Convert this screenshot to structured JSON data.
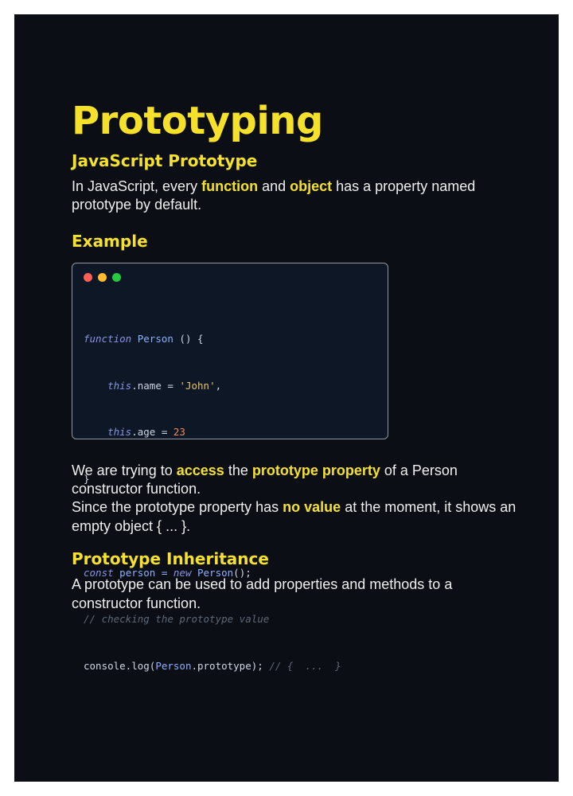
{
  "title": "Prototyping",
  "section1": {
    "heading": "JavaScript Prototype",
    "p1": "In JavaScript, every ",
    "p1_hl1": "function",
    "p1_mid": " and ",
    "p1_hl2": "object",
    "p1_end": " has a property named prototype by default."
  },
  "example": {
    "heading": "Example"
  },
  "code": {
    "l1_kw": "function",
    "l1_fn": " Person",
    "l1_rest": " () {",
    "l2_kw": "    this",
    "l2_rest": ".name = ",
    "l2_str": "'John'",
    "l2_end": ",",
    "l3_kw": "    this",
    "l3_rest": ".age = ",
    "l3_num": "23",
    "l4": "}",
    "l6_kw": "const",
    "l6_var": " person = ",
    "l6_new": "new",
    "l6_fn": " Person",
    "l6_end": "();",
    "l7_cm": "// checking the prototype value",
    "l8_a": "console.log(",
    "l8_fn": "Person",
    "l8_b": ".prototype); ",
    "l8_cm": "// {  ...  }"
  },
  "explain": {
    "a": "We are trying to ",
    "hl1": "access",
    "b": " the ",
    "hl2": "prototype property",
    "c": " of a Person constructor function.",
    "d": "Since the prototype property has ",
    "hl3": "no value",
    "e": " at the moment, it shows an empty object { ... }."
  },
  "section2": {
    "heading": "Prototype Inheritance",
    "text": "A prototype can be used to add properties and methods to a constructor function."
  },
  "colors": {
    "accent": "#f5e02b",
    "background": "#0b0f15",
    "code_bg": "#0d1726"
  }
}
